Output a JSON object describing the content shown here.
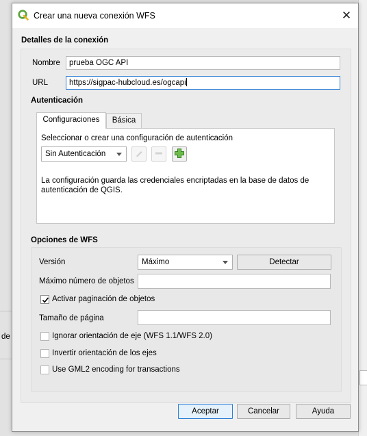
{
  "window": {
    "title": "Crear una nueva conexión WFS",
    "close_label": "✕"
  },
  "background": {
    "fragment_text": "de"
  },
  "connection_details": {
    "section_title": "Detalles de la conexión",
    "name_label": "Nombre",
    "name_value": "prueba OGC API",
    "url_label": "URL",
    "url_value": "https://sigpac-hubcloud.es/ogcapi"
  },
  "authentication": {
    "section_title": "Autenticación",
    "tabs": [
      {
        "label": "Configuraciones",
        "active": true
      },
      {
        "label": "Básica",
        "active": false
      }
    ],
    "select_prompt": "Seleccionar o crear una configuración de autenticación",
    "auth_config_selected": "Sin Autenticación",
    "edit_icon": "pencil-icon",
    "remove_icon": "minus-icon",
    "add_icon": "plus-icon",
    "info_text_line1": "La configuración guarda las credenciales encriptadas en la base de datos de",
    "info_text_line2": "autenticación de QGIS."
  },
  "wfs_options": {
    "section_title": "Opciones de WFS",
    "version_label": "Versión",
    "version_selected": "Máximo",
    "detect_button": "Detectar",
    "max_features_label": "Máximo número de objetos",
    "max_features_value": "",
    "paging_label": "Activar paginación de objetos",
    "paging_checked": true,
    "page_size_label": "Tamaño de página",
    "page_size_value": "",
    "ignore_axis_label": "Ignorar orientación de eje (WFS 1.1/WFS 2.0)",
    "ignore_axis_checked": false,
    "invert_axis_label": "Invertir orientación de los ejes",
    "invert_axis_checked": false,
    "gml2_label": "Use GML2 encoding for transactions",
    "gml2_checked": false
  },
  "buttons": {
    "accept": "Aceptar",
    "cancel": "Cancelar",
    "help": "Ayuda"
  },
  "colors": {
    "focus_border": "#2f7fd6",
    "qgis_green": "#5aa33a"
  }
}
